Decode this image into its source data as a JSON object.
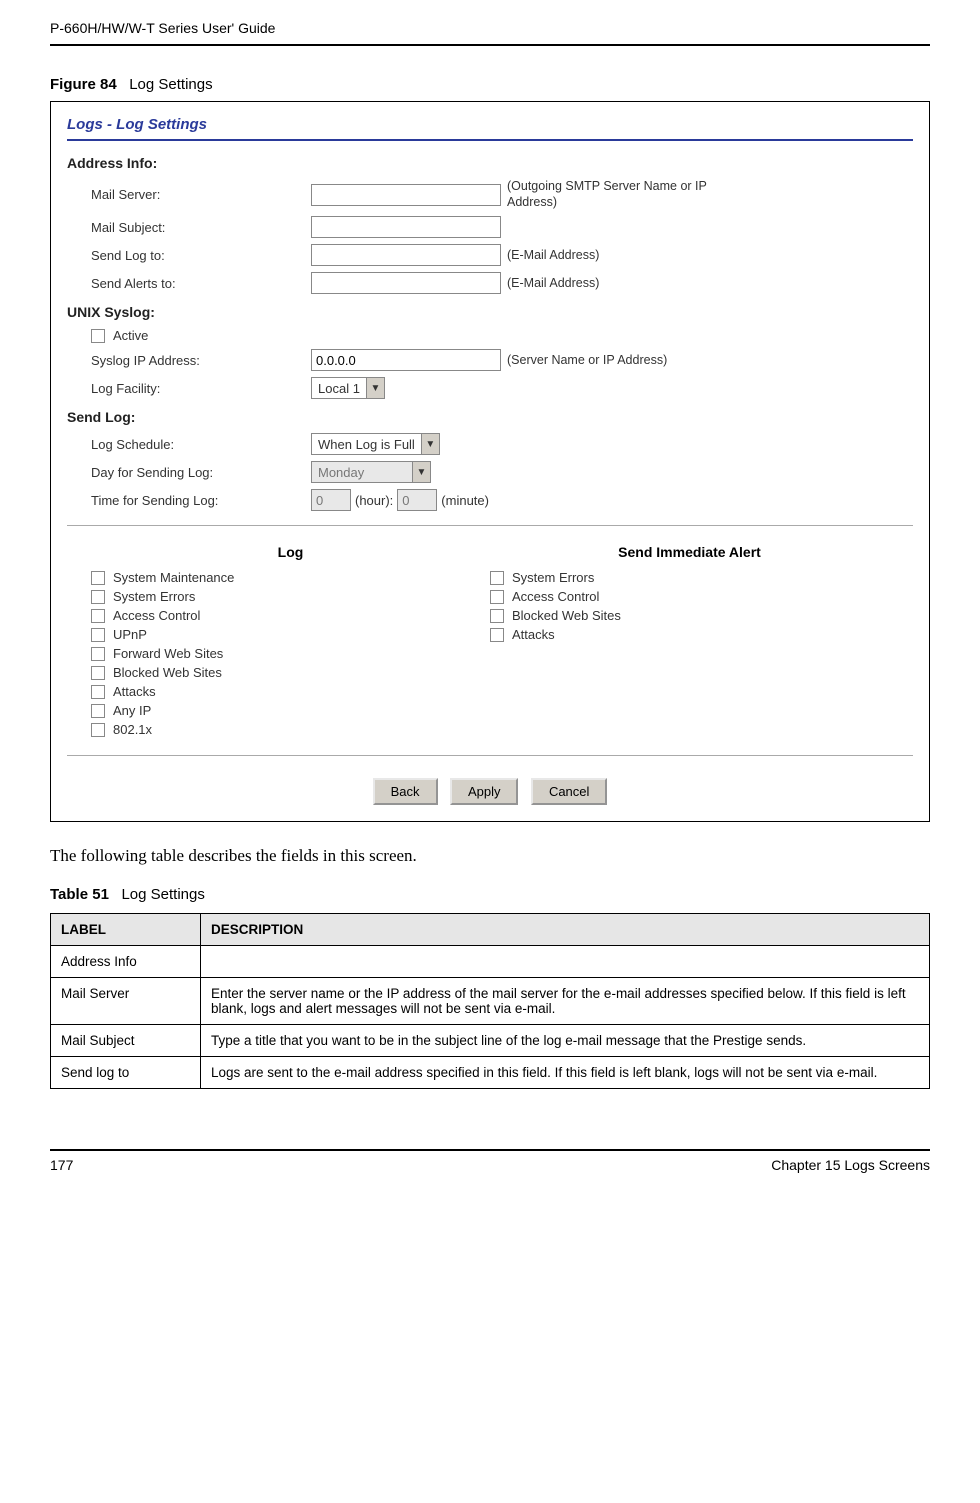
{
  "doc": {
    "guide_title": "P-660H/HW/W-T Series User' Guide",
    "page_number": "177",
    "chapter": "Chapter 15 Logs Screens"
  },
  "figure": {
    "prefix": "Figure 84",
    "title": "Log Settings"
  },
  "panel": {
    "title": "Logs - Log Settings",
    "sections": {
      "address": {
        "title": "Address Info:",
        "mail_server_label": "Mail Server:",
        "mail_server_hint": "(Outgoing SMTP Server Name or IP Address)",
        "mail_subject_label": "Mail Subject:",
        "send_log_to_label": "Send Log to:",
        "send_log_to_hint": "(E-Mail Address)",
        "send_alerts_to_label": "Send Alerts to:",
        "send_alerts_to_hint": "(E-Mail Address)"
      },
      "syslog": {
        "title": "UNIX Syslog:",
        "active_label": "Active",
        "ip_label": "Syslog IP Address:",
        "ip_value": "0.0.0.0",
        "ip_hint": "(Server Name or IP Address)",
        "facility_label": "Log Facility:",
        "facility_value": "Local 1"
      },
      "sendlog": {
        "title": "Send Log:",
        "schedule_label": "Log Schedule:",
        "schedule_value": "When Log is Full",
        "day_label": "Day for Sending Log:",
        "day_value": "Monday",
        "time_label": "Time for Sending Log:",
        "hour_value": "0",
        "hour_suffix": "(hour):",
        "minute_value": "0",
        "minute_suffix": "(minute)"
      },
      "logcols": {
        "log_header": "Log",
        "alert_header": "Send Immediate Alert",
        "log_items": {
          "i0": "System Maintenance",
          "i1": "System Errors",
          "i2": "Access Control",
          "i3": "UPnP",
          "i4": "Forward Web Sites",
          "i5": "Blocked Web Sites",
          "i6": "Attacks",
          "i7": "Any IP",
          "i8": "802.1x"
        },
        "alert_items": {
          "a0": "System Errors",
          "a1": "Access Control",
          "a2": "Blocked Web Sites",
          "a3": "Attacks"
        }
      }
    },
    "buttons": {
      "back": "Back",
      "apply": "Apply",
      "cancel": "Cancel"
    }
  },
  "body_text": "The following table describes the fields in this screen.",
  "table": {
    "prefix": "Table 51",
    "title": "Log Settings",
    "head_label": "LABEL",
    "head_desc": "DESCRIPTION",
    "rows": {
      "r0": {
        "label": "Address Info",
        "desc": ""
      },
      "r1": {
        "label": "Mail Server",
        "desc": "Enter the server name or the IP address of the mail server for the e-mail addresses specified below. If this field is left blank, logs and alert messages will not be sent via e-mail."
      },
      "r2": {
        "label": "Mail Subject",
        "desc": "Type a title that you want to be in the subject line of the log e-mail message that the Prestige sends."
      },
      "r3": {
        "label": "Send log to",
        "desc": "Logs are sent to the e-mail address specified in this field. If this field is left blank, logs will not be sent via e-mail."
      }
    }
  }
}
